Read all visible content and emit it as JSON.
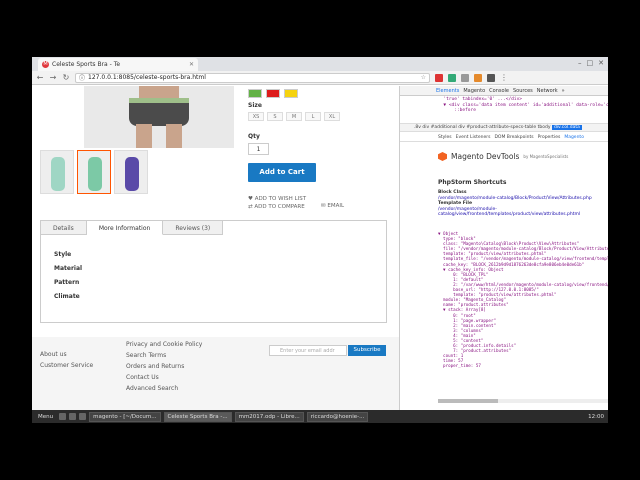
{
  "browser": {
    "tab_title": "Celeste Sports Bra - Te",
    "url": "127.0.0.1:8085/celeste-sports-bra.html"
  },
  "product": {
    "size_label": "Size",
    "sizes": [
      "XS",
      "S",
      "M",
      "L",
      "XL"
    ],
    "qty_label": "Qty",
    "qty_value": "1",
    "add_to_cart": "Add to Cart",
    "wishlist": "ADD TO WISH LIST",
    "compare": "ADD TO COMPARE",
    "email": "EMAIL",
    "swatch_colors": [
      "#63b246",
      "#dd1c1c",
      "#f5d30f"
    ]
  },
  "tabs": [
    "Details",
    "More Information",
    "Reviews (3)"
  ],
  "attributes": [
    "Style",
    "Material",
    "Pattern",
    "Climate"
  ],
  "footer": {
    "col1": [
      "About us",
      "Customer Service"
    ],
    "col2": [
      "Privacy and Cookie Policy",
      "Search Terms",
      "Orders and Returns",
      "Contact Us",
      "Advanced Search"
    ],
    "newsletter_placeholder": "Enter your email addr",
    "subscribe": "Subscribe"
  },
  "devtools": {
    "tabs": [
      "Elements",
      "Magento",
      "Console",
      "Sources",
      "Network",
      "»"
    ],
    "html_code": "  'true' tabindex='0' ...</div>\n  ▼ <div class='data item content' id='additional' data-role='content' aria-labelledby='tab-label-additional' role='tabpanel' aria-hidden='false' style='display: block;'>\n      ::before",
    "breadcrumb": [
      ".8v",
      "div",
      "#additional",
      "div",
      "#product-attribute-specs-table",
      "tbody"
    ],
    "breadcrumb_selected": "div.col.data",
    "subtabs": [
      "Styles",
      "Event Listeners",
      "DOM Breakpoints",
      "Properties",
      "Magento"
    ],
    "magento_title": "Magento DevTools",
    "magento_by": "by MagentoSpecialists",
    "phpstorm_title": "PhpStorm Shortcuts",
    "block_class_label": "Block Class",
    "block_class_value": "/vendor/magento/module-catalog/Block/Product/View/Attributes.php",
    "template_label": "Template File",
    "template_value": "/vendor/magento/module-catalog/view/frontend/templates/product/view/attributes.phtml",
    "object_dump": "▼ Object\n  type: \"block\"\n  class: \"Magento\\Catalog\\Block\\Product\\View\\Attributes\"\n  file: \"/vendor/magento/module-catalog/Block/Product/View/Attributes.php\"\n  template: \"product/view/attributes.phtml\"\n  template_file: \"/vendor/magento/module-catalog/view/frontend/templates/product/...\"\n  cache_key: \"BLOCK_2612b9d9d1876263de8cfa9e806eb4e0de61b\"\n  ▼ cache_key_info: Object\n      0: \"BLOCK_TPL\"\n      1: \"default\"\n      2: \"/var/www/html/vendor/magento/module-catalog/view/frontend/templates/...\"\n      base_url: \"http://127.0.0.1:8085/\"\n      template: \"product/view/attributes.phtml\"\n  module: \"Magento_Catalog\"\n  name: \"product.attributes\"\n  ▼ stack: Array[8]\n      0: \"root\"\n      1: \"page.wrapper\"\n      2: \"main.content\"\n      3: \"columns\"\n      4: \"main\"\n      5: \"content\"\n      6: \"product.info.details\"\n      7: \"product.attributes\"\n  count: 1\n  time: 57\n  proper_time: 57"
  },
  "taskbar": {
    "menu": "Menu",
    "tasks": [
      "magento - [~/Docum...",
      "Celeste Sports Bra -...",
      "mm2017.odp - Libre...",
      "riccardo@hoenie-..."
    ],
    "clock": "12:00"
  }
}
